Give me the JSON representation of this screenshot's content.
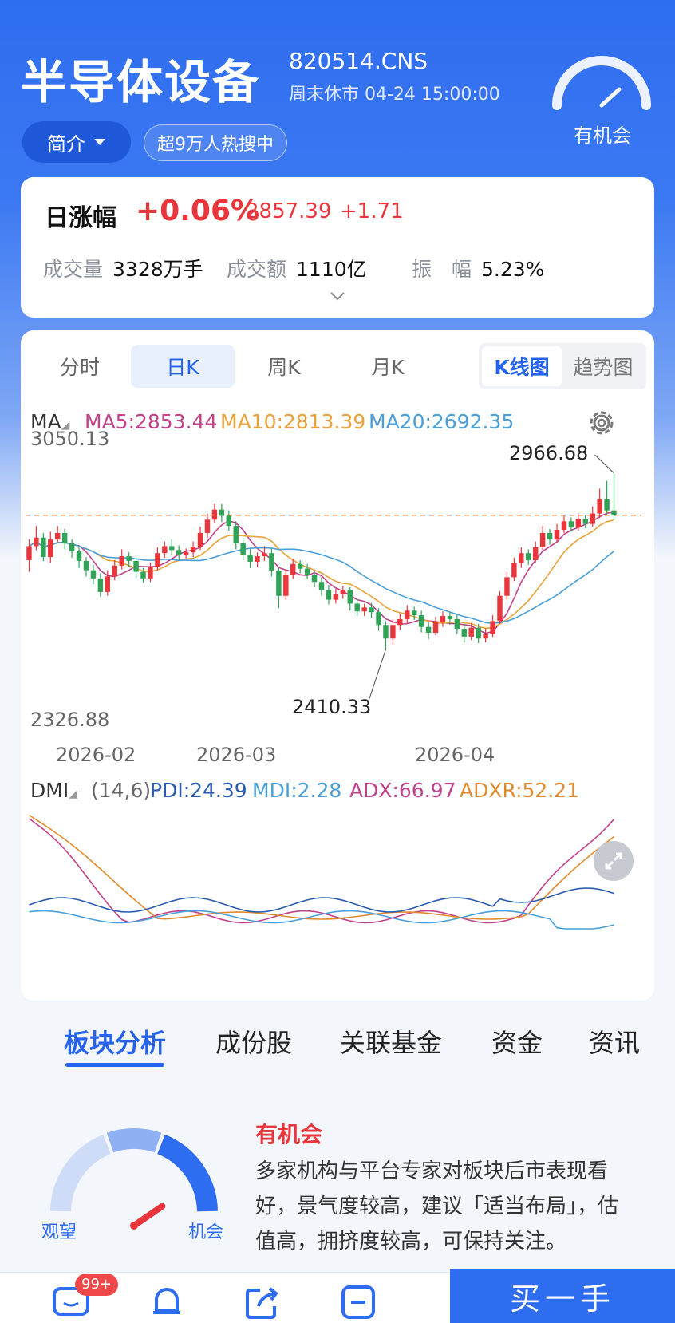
{
  "header": {
    "title": "半导体设备",
    "code": "820514.CNS",
    "status": "周末休市  04-24 15:00:00",
    "sentiment": "有机会",
    "intro_button": "简介",
    "hot_tag": "超9万人热搜中"
  },
  "quote": {
    "label": "日涨幅",
    "change_pct": "+0.06%",
    "price": "2857.39",
    "change": "+1.71",
    "volume_label": "成交量",
    "volume": "3328万手",
    "amount_label": "成交额",
    "amount": "1110亿",
    "amplitude_label": "振　幅",
    "amplitude": "5.23%"
  },
  "chart_tabs": [
    "分时",
    "日K",
    "周K",
    "月K"
  ],
  "chart_toggle": [
    "K线图",
    "趋势图"
  ],
  "ma_legend": {
    "name": "MA",
    "ma5": "MA5:2853.44",
    "ma10": "MA10:2813.39",
    "ma20": "MA20:2692.35"
  },
  "colors": {
    "up": "#e8363c",
    "down": "#2fa356",
    "ma5": "#c0428a",
    "ma10": "#e8a23c",
    "ma20": "#4a9fd8",
    "pdi": "#2a5bb0",
    "mdi": "#4a9fd8",
    "adx": "#c0428a",
    "adxr": "#e08a2c",
    "accent": "#2f6df0"
  },
  "chart_data": {
    "type": "candlestick",
    "ylim": [
      2326.88,
      3050.13
    ],
    "y_top_label": "3050.13",
    "y_bottom_label": "2326.88",
    "high_marker": "2966.68",
    "low_marker": "2410.33",
    "x_labels": [
      "2026-02",
      "2026-03",
      "2026-04"
    ],
    "reference_line": 2857.39,
    "candles": [
      [
        2742,
        2778,
        2796,
        2712
      ],
      [
        2778,
        2800,
        2830,
        2768
      ],
      [
        2800,
        2750,
        2812,
        2740
      ],
      [
        2750,
        2795,
        2815,
        2735
      ],
      [
        2795,
        2812,
        2830,
        2788
      ],
      [
        2812,
        2785,
        2822,
        2770
      ],
      [
        2785,
        2765,
        2795,
        2748
      ],
      [
        2765,
        2740,
        2778,
        2722
      ],
      [
        2740,
        2716,
        2750,
        2700
      ],
      [
        2716,
        2695,
        2730,
        2680
      ],
      [
        2695,
        2660,
        2708,
        2648
      ],
      [
        2660,
        2700,
        2716,
        2650
      ],
      [
        2700,
        2728,
        2742,
        2690
      ],
      [
        2728,
        2752,
        2770,
        2718
      ],
      [
        2752,
        2740,
        2762,
        2725
      ],
      [
        2740,
        2712,
        2750,
        2698
      ],
      [
        2712,
        2695,
        2722,
        2684
      ],
      [
        2695,
        2725,
        2736,
        2686
      ],
      [
        2725,
        2760,
        2775,
        2716
      ],
      [
        2760,
        2778,
        2790,
        2748
      ],
      [
        2778,
        2768,
        2796,
        2756
      ],
      [
        2768,
        2755,
        2780,
        2742
      ],
      [
        2755,
        2762,
        2772,
        2744
      ],
      [
        2762,
        2776,
        2790,
        2750
      ],
      [
        2776,
        2812,
        2828,
        2768
      ],
      [
        2812,
        2846,
        2862,
        2800
      ],
      [
        2846,
        2872,
        2888,
        2838
      ],
      [
        2872,
        2856,
        2888,
        2840
      ],
      [
        2856,
        2830,
        2870,
        2818
      ],
      [
        2830,
        2785,
        2842,
        2770
      ],
      [
        2785,
        2755,
        2800,
        2742
      ],
      [
        2755,
        2738,
        2770,
        2722
      ],
      [
        2738,
        2752,
        2762,
        2724
      ],
      [
        2752,
        2760,
        2778,
        2740
      ],
      [
        2760,
        2715,
        2772,
        2700
      ],
      [
        2715,
        2650,
        2722,
        2618
      ],
      [
        2650,
        2705,
        2718,
        2640
      ],
      [
        2705,
        2732,
        2746,
        2694
      ],
      [
        2732,
        2720,
        2742,
        2708
      ],
      [
        2720,
        2705,
        2732,
        2692
      ],
      [
        2705,
        2686,
        2716,
        2672
      ],
      [
        2686,
        2665,
        2698,
        2650
      ],
      [
        2665,
        2640,
        2678,
        2628
      ],
      [
        2640,
        2655,
        2668,
        2630
      ],
      [
        2655,
        2665,
        2676,
        2642
      ],
      [
        2665,
        2630,
        2672,
        2612
      ],
      [
        2630,
        2610,
        2642,
        2598
      ],
      [
        2610,
        2620,
        2630,
        2598
      ],
      [
        2620,
        2608,
        2632,
        2594
      ],
      [
        2608,
        2575,
        2618,
        2560
      ],
      [
        2575,
        2540,
        2585,
        2512
      ],
      [
        2540,
        2575,
        2590,
        2525
      ],
      [
        2575,
        2590,
        2604,
        2562
      ],
      [
        2590,
        2612,
        2626,
        2580
      ],
      [
        2612,
        2600,
        2622,
        2588
      ],
      [
        2600,
        2570,
        2612,
        2556
      ],
      [
        2570,
        2555,
        2582,
        2538
      ],
      [
        2555,
        2582,
        2596,
        2548
      ],
      [
        2582,
        2598,
        2610,
        2570
      ],
      [
        2598,
        2590,
        2608,
        2576
      ],
      [
        2590,
        2565,
        2602,
        2552
      ],
      [
        2565,
        2545,
        2578,
        2530
      ],
      [
        2545,
        2568,
        2580,
        2536
      ],
      [
        2568,
        2540,
        2578,
        2528
      ],
      [
        2540,
        2552,
        2566,
        2530
      ],
      [
        2552,
        2585,
        2600,
        2544
      ],
      [
        2585,
        2650,
        2662,
        2578
      ],
      [
        2650,
        2698,
        2712,
        2640
      ],
      [
        2698,
        2735,
        2748,
        2688
      ],
      [
        2735,
        2760,
        2775,
        2722
      ],
      [
        2760,
        2742,
        2770,
        2730
      ],
      [
        2742,
        2775,
        2790,
        2736
      ],
      [
        2775,
        2812,
        2830,
        2768
      ],
      [
        2812,
        2795,
        2822,
        2782
      ],
      [
        2795,
        2820,
        2835,
        2788
      ],
      [
        2820,
        2842,
        2856,
        2812
      ],
      [
        2842,
        2826,
        2852,
        2815
      ],
      [
        2826,
        2848,
        2862,
        2818
      ],
      [
        2848,
        2835,
        2858,
        2824
      ],
      [
        2835,
        2862,
        2880,
        2828
      ],
      [
        2862,
        2900,
        2926,
        2850
      ],
      [
        2900,
        2870,
        2946,
        2858
      ],
      [
        2870,
        2857,
        2966,
        2845
      ]
    ],
    "dmi": {
      "params": "(14,6)",
      "pdi": "PDI:24.39",
      "mdi": "MDI:2.28",
      "adx": "ADX:66.97",
      "adxr": "ADXR:52.21"
    }
  },
  "section_tabs": [
    "板块分析",
    "成份股",
    "关联基金",
    "资金",
    "资讯"
  ],
  "opinion": {
    "title": "有机会",
    "description": "多家机构与平台专家对板块后市表现看好，景气度较高，建议「适当布局」，估值高，拥挤度较高，可保持关注。",
    "gauge_low": "观望",
    "gauge_high": "机会",
    "level": 0.7
  },
  "bottom_bar": {
    "badge": "99+",
    "buy_button": "买一手"
  }
}
